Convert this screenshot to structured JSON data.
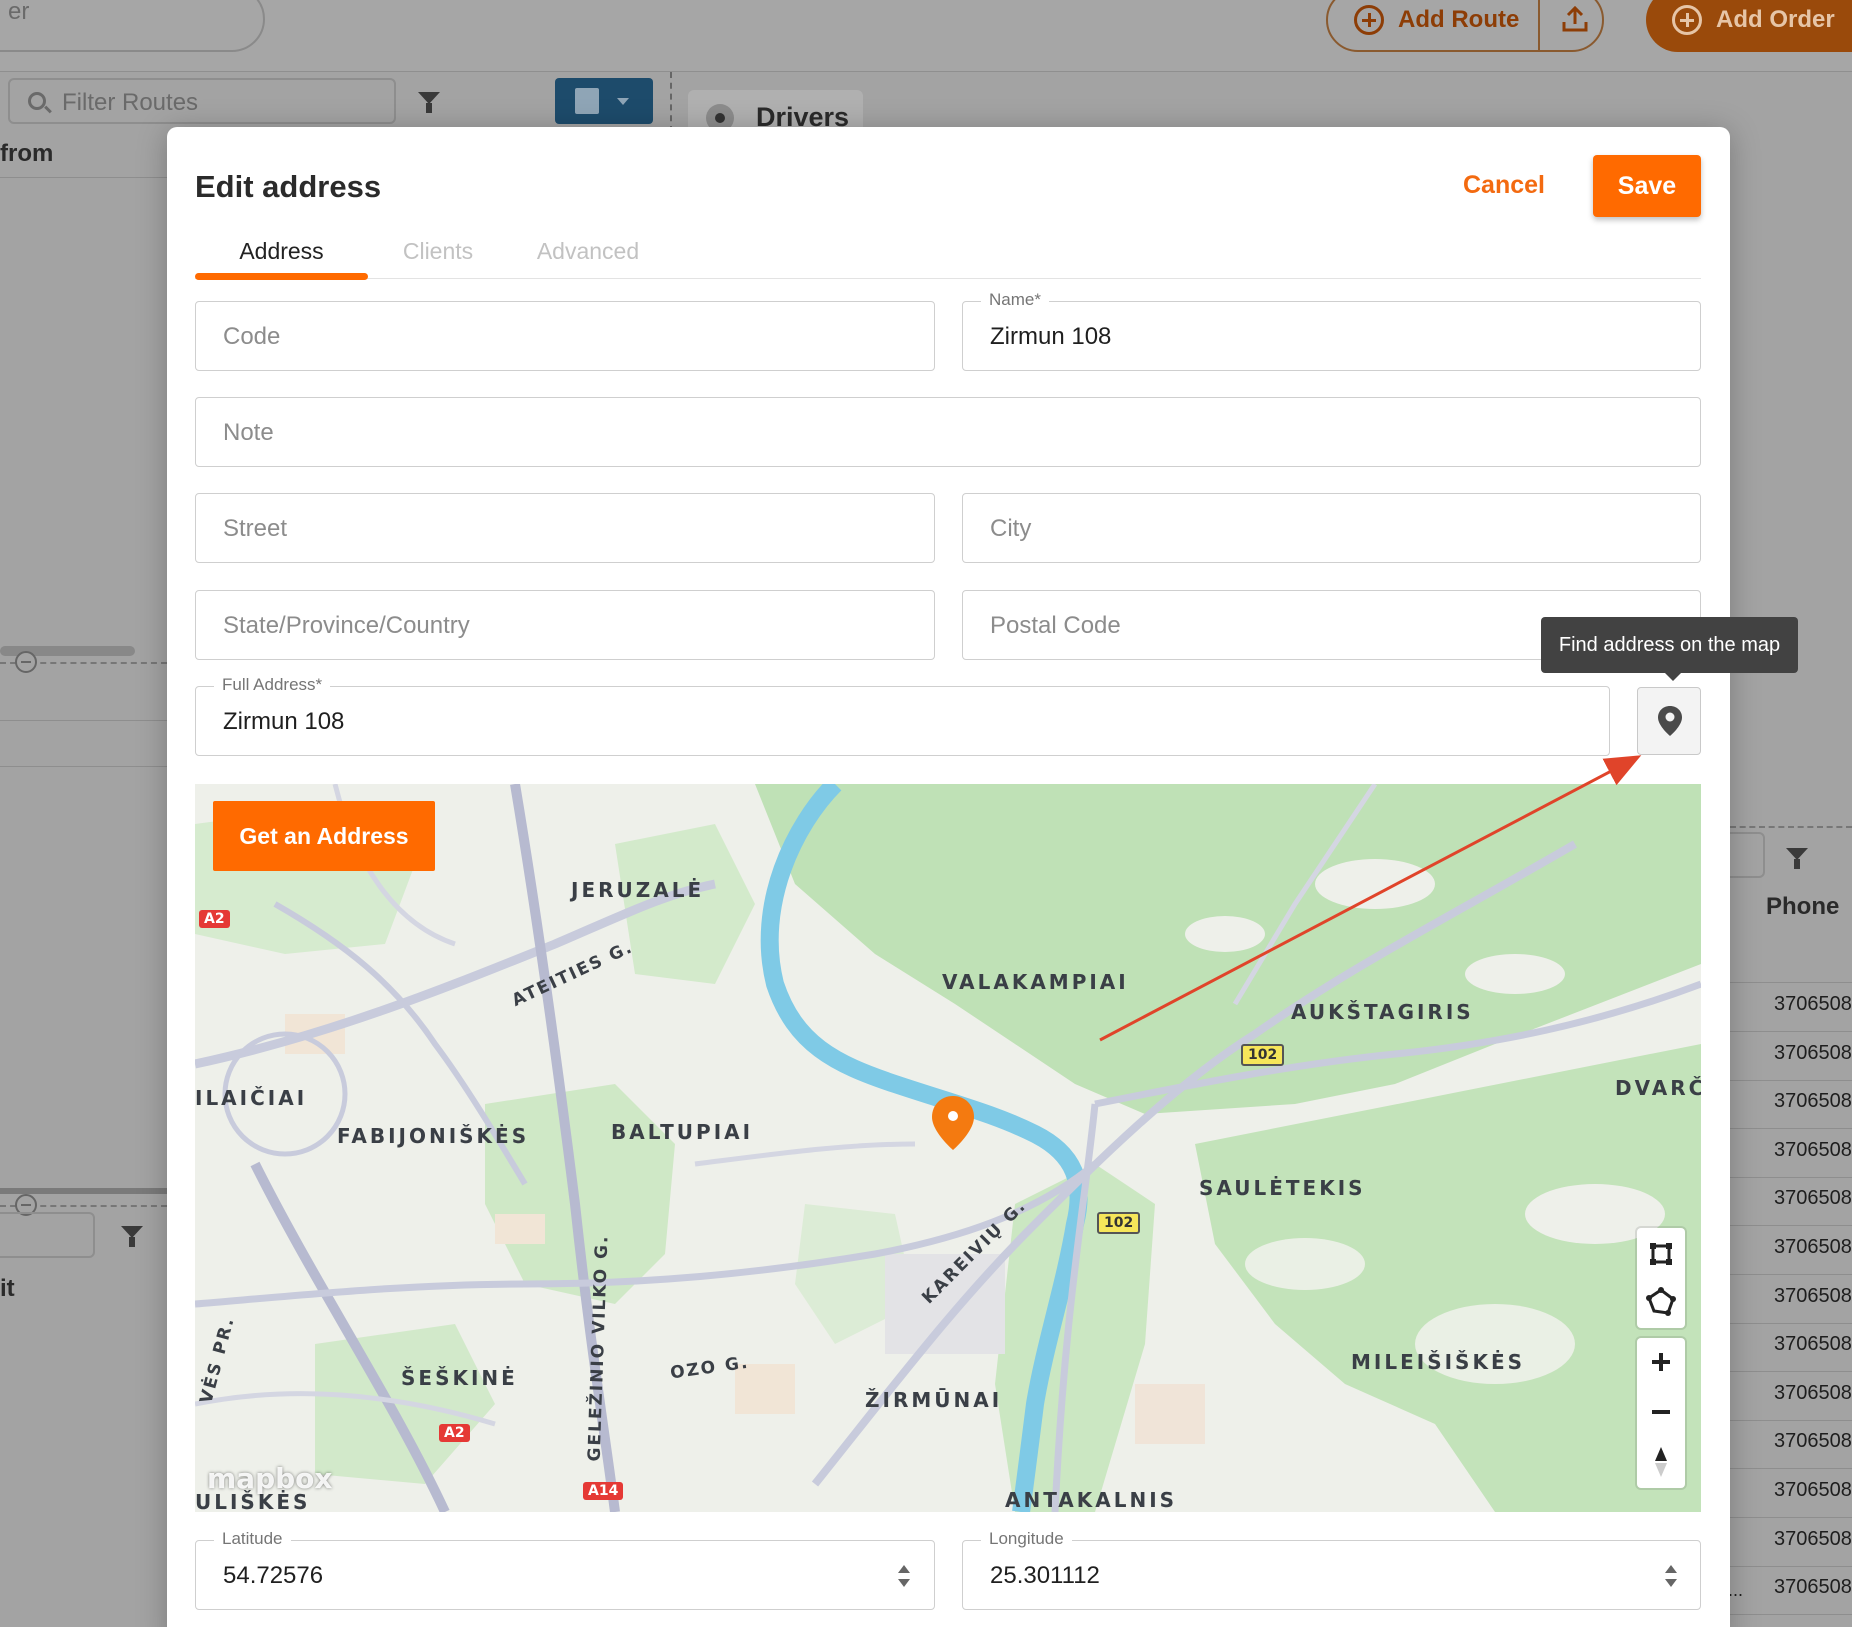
{
  "background": {
    "search_partial": "er",
    "add_route_label": "Add Route",
    "add_order_label": "Add Order",
    "filter_routes_placeholder": "Filter Routes",
    "drivers_tab_label": "Drivers",
    "from_label": "from",
    "it_label": "it",
    "phone_header": "Phone",
    "phone_rows": [
      "3706508",
      "3706508",
      "3706508",
      "3706508",
      "3706508",
      "3706508",
      "3706508",
      "3706508",
      "3706508",
      "3706508",
      "3706508",
      "3706508",
      "3706508"
    ],
    "ellipsis": "..."
  },
  "modal": {
    "title": "Edit address",
    "cancel_label": "Cancel",
    "save_label": "Save",
    "tabs": [
      {
        "label": "Address",
        "active": true
      },
      {
        "label": "Clients",
        "active": false
      },
      {
        "label": "Advanced",
        "active": false
      }
    ],
    "fields": {
      "code": {
        "placeholder": "Code",
        "value": ""
      },
      "name": {
        "label": "Name*",
        "value": "Zirmun 108"
      },
      "note": {
        "placeholder": "Note",
        "value": ""
      },
      "street": {
        "placeholder": "Street",
        "value": ""
      },
      "city": {
        "placeholder": "City",
        "value": ""
      },
      "state": {
        "placeholder": "State/Province/Country",
        "value": ""
      },
      "postal": {
        "placeholder": "Postal Code",
        "value": ""
      },
      "full_address": {
        "label": "Full Address*",
        "value": "Zirmun 108"
      },
      "latitude": {
        "label": "Latitude",
        "value": "54.72576"
      },
      "longitude": {
        "label": "Longitude",
        "value": "25.301112"
      }
    },
    "find_on_map_tooltip": "Find address on the map",
    "find_on_map_icon": "map-pin-icon",
    "map": {
      "get_address_label": "Get an Address",
      "attribution": "mapbox",
      "districts": [
        "JERUZALĖ",
        "VALAKAMPIAI",
        "AUKŠTAGIRIS",
        "ILAIČIAI",
        "FABIJONIŠKĖS",
        "BALTUPIAI",
        "DVARČI",
        "SAULĖTEKIS",
        "MILEIŠIŠKĖS",
        "ŠEŠKINĖ",
        "ŽIRMŪNAI",
        "ULIŠKĖS",
        "ANTAKALNIS"
      ],
      "streets": [
        "ATEITIES G.",
        "KAREIVIŲ G.",
        "GELEŽINIO VILKO G.",
        "OZO G.",
        "VĖS PR."
      ],
      "road_shields": [
        "A2",
        "A2",
        "A14",
        "102",
        "102"
      ],
      "controls": [
        "draw-rectangle-icon",
        "draw-polygon-icon",
        "zoom-in-icon",
        "zoom-out-icon",
        "compass-icon"
      ]
    }
  },
  "colors": {
    "accent": "#ff6a00",
    "tooltip_bg": "#424242",
    "annotation_arrow": "#e0442a"
  }
}
